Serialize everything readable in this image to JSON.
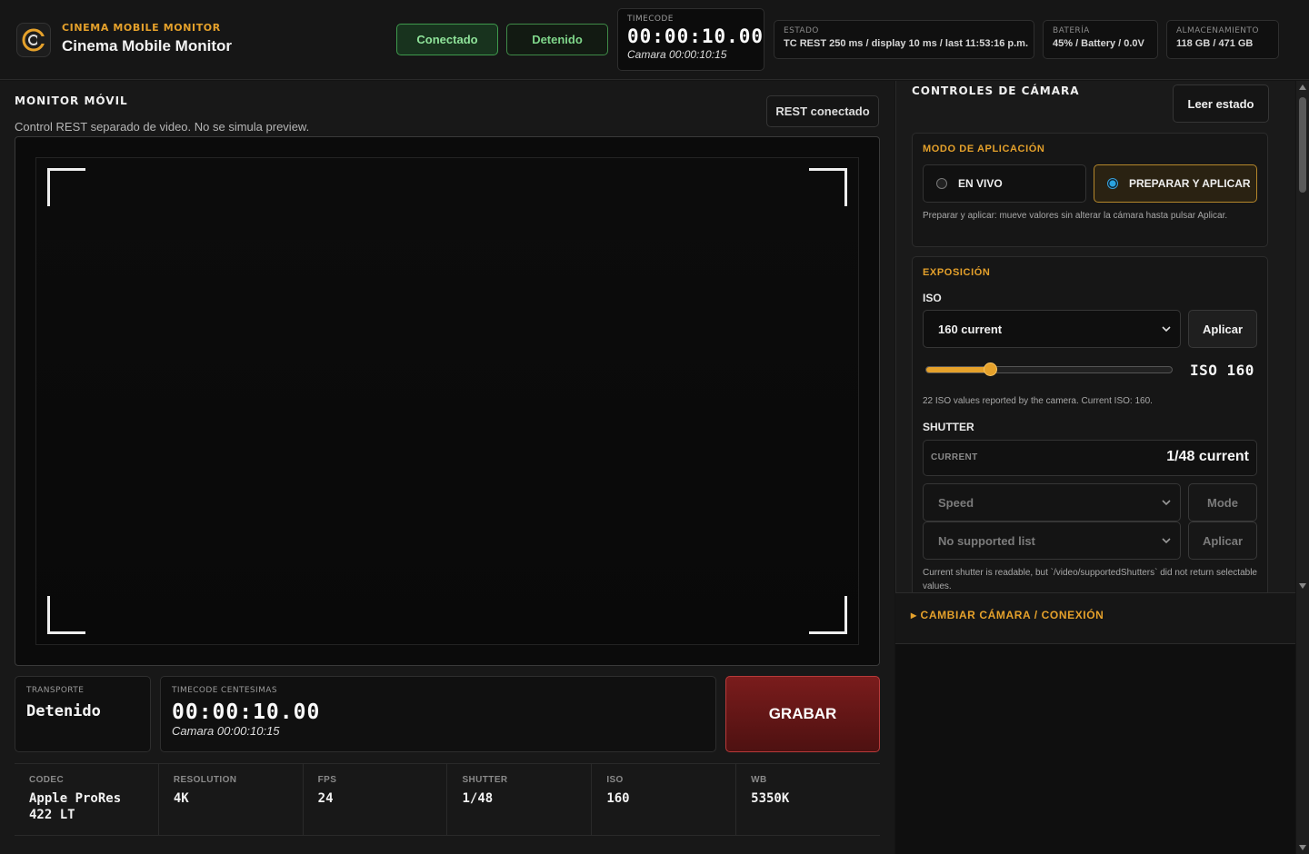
{
  "header": {
    "eyebrow": "CINEMA MOBILE MONITOR",
    "title": "Cinema Mobile Monitor",
    "status_connected": "Conectado",
    "status_transport": "Detenido",
    "timecode": {
      "label": "TIMECODE",
      "value": "00:00:10.00",
      "camera": "Camara 00:00:10:15"
    },
    "estado": {
      "label": "ESTADO",
      "value": "TC REST 250 ms / display 10 ms / last 11:53:16 p.m."
    },
    "bateria": {
      "label": "BATERÍA",
      "value": "45% / Battery / 0.0V"
    },
    "almacenamiento": {
      "label": "ALMACENAMIENTO",
      "value": "118 GB / 471 GB"
    }
  },
  "monitor": {
    "title": "MONITOR MÓVIL",
    "subtitle": "Control REST separado de video. No se simula preview.",
    "rest_button": "REST conectado"
  },
  "transport": {
    "label": "TRANSPORTE",
    "value": "Detenido"
  },
  "timecode_cent": {
    "label": "TIMECODE CENTESIMAS",
    "value": "00:00:10.00",
    "camera": "Camara 00:00:10:15"
  },
  "record_button": "GRABAR",
  "specs": [
    {
      "label": "CODEC",
      "value": "Apple ProRes 422 LT"
    },
    {
      "label": "RESOLUTION",
      "value": "4K"
    },
    {
      "label": "FPS",
      "value": "24"
    },
    {
      "label": "SHUTTER",
      "value": "1/48"
    },
    {
      "label": "ISO",
      "value": "160"
    },
    {
      "label": "WB",
      "value": "5350K"
    }
  ],
  "controls": {
    "title": "CONTROLES DE CÁMARA",
    "read_button": "Leer estado",
    "mode": {
      "title": "MODO DE APLICACIÓN",
      "live": "EN VIVO",
      "prepare": "PREPARAR Y APLICAR",
      "selected": "prepare",
      "note": "Preparar y aplicar: mueve valores sin alterar la cámara hasta pulsar Aplicar."
    },
    "exposure": {
      "title": "EXPOSICIÓN",
      "iso_label": "ISO",
      "iso_select": "160 current",
      "iso_apply": "Aplicar",
      "iso_slider_fraction": 0.26,
      "iso_readout": "ISO 160",
      "iso_note": "22 ISO values reported by the camera. Current ISO: 160.",
      "shutter_label": "SHUTTER",
      "current_label": "CURRENT",
      "current_value": "1/48 current",
      "speed_select": "Speed",
      "mode_button": "Mode",
      "supported_select": "No supported list",
      "shutter_apply": "Aplicar",
      "shutter_note": "Current shutter is readable, but `/video/supportedShutters` did not return selectable values."
    }
  },
  "camera_connection": "▸ CAMBIAR CÁMARA / CONEXIÓN",
  "colors": {
    "accent": "#e5a12b",
    "connected": "#3f9a4d",
    "record": "#7a1c1c",
    "radio_on": "#2aa3e0"
  }
}
